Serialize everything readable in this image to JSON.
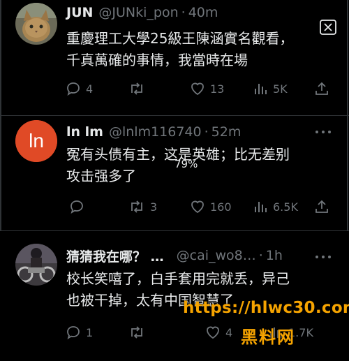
{
  "tweets": [
    {
      "name": "JUN",
      "handle": "@JUNki_pon",
      "sep": "·",
      "time": "40m",
      "lines": [
        "重慶理工大學25級王陳涵實名觀看，",
        "千真萬確的事情，我當時在場"
      ],
      "replies": "4",
      "retweets": "",
      "likes": "13",
      "views": "5K",
      "avatar_icon": "cat-photo"
    },
    {
      "name": "ln lm",
      "handle": "@lnlm116740",
      "sep": "·",
      "time": "52m",
      "lines": [
        "冤有头债有主，这是英雄；比无差别",
        "攻击强多了"
      ],
      "replies": "",
      "retweets": "3",
      "likes": "160",
      "views": "6.5K",
      "avatar_text": "ln",
      "avatar_color": "#e04a26"
    },
    {
      "name": "猜猜我在哪？ …",
      "handle": "@cai_wo8…",
      "sep": "·",
      "time": "1h",
      "lines": [
        "校长笑嘻了，白手套用完就丢，异己",
        "也被干掉，太有中国智慧了"
      ],
      "replies": "1",
      "retweets": "",
      "likes": "4",
      "views": "1.7K",
      "avatar_icon": "motorcycle-photo"
    }
  ],
  "overlay": {
    "percent": "79%",
    "watermark_url": "https://hlwc30.com",
    "watermark_label": "黑料网"
  },
  "colors": {
    "background": "#000000",
    "text": "#e7e9ea",
    "muted": "#71767b",
    "divider": "#2f3336",
    "watermark": "#f5a300"
  }
}
